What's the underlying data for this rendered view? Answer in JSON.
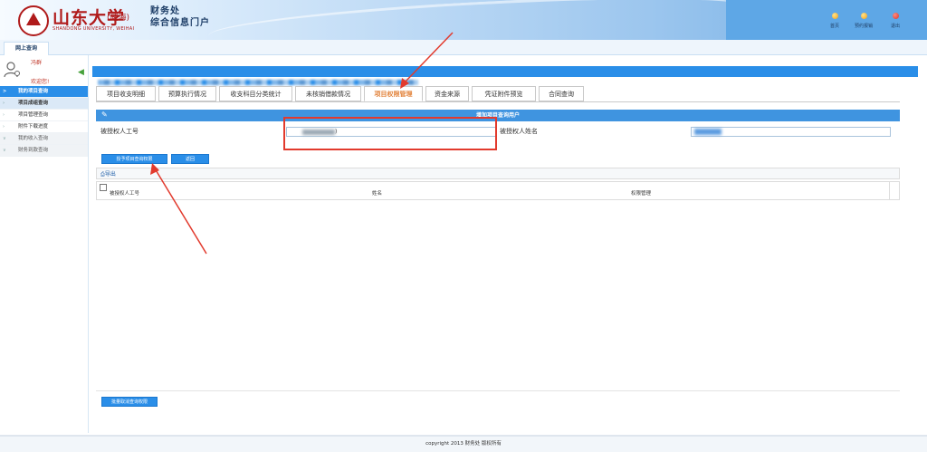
{
  "header": {
    "university_name": "山东大学",
    "campus": "(威海)",
    "university_en": "SHANDONG UNIVERSITY, WEIHAI",
    "dept": "财务处",
    "portal": "综合信息门户",
    "nav": [
      {
        "label": "首页",
        "color": "#f0a019"
      },
      {
        "label": "预约报销",
        "color": "#f0a019"
      },
      {
        "label": "退出",
        "color": "#d9362b"
      }
    ]
  },
  "strip": {
    "tab": "网上查询"
  },
  "sidebar": {
    "user_name": "冯群",
    "welcome": "欢迎您!",
    "items": [
      {
        "label": "我的项目查询",
        "marker": ">",
        "state": "active"
      },
      {
        "label": "项目成组查询",
        "marker": "›",
        "state": "child-active"
      },
      {
        "label": "项目管理查询",
        "marker": "›",
        "state": "normal"
      },
      {
        "label": "附件下载进度",
        "marker": "›",
        "state": "normal"
      },
      {
        "label": "我的收入查询",
        "marker": "∨",
        "state": "group"
      },
      {
        "label": "财务到款查询",
        "marker": "∨",
        "state": "group"
      }
    ]
  },
  "main": {
    "tabs": [
      {
        "label": "项目收支明细"
      },
      {
        "label": "预算执行情况"
      },
      {
        "label": "收支科目分类统计"
      },
      {
        "label": "未核销借款情况"
      },
      {
        "label": "项目权限管理",
        "active": true
      },
      {
        "label": "资金来源"
      },
      {
        "label": "凭证附件预览"
      },
      {
        "label": "合同查询"
      }
    ],
    "panel_title": "增加项目查询用户",
    "form": {
      "id_label": "被授权人工号",
      "id_value_suffix": ")",
      "name_label": "被授权人姓名"
    },
    "buttons": {
      "grant": "授予项目查询权限",
      "back": "返回",
      "batch_revoke": "批量取消查询权限"
    },
    "toolbar": {
      "export": "导出"
    },
    "grid": {
      "columns": [
        "被授权人工号",
        "姓名",
        "权限管理"
      ]
    }
  },
  "footer": {
    "copyright": "copyright 2013 财务处 版权所有"
  },
  "colors": {
    "accent": "#2a8ee8",
    "active_tab": "#e2823a",
    "annotation": "#e23a2d"
  }
}
